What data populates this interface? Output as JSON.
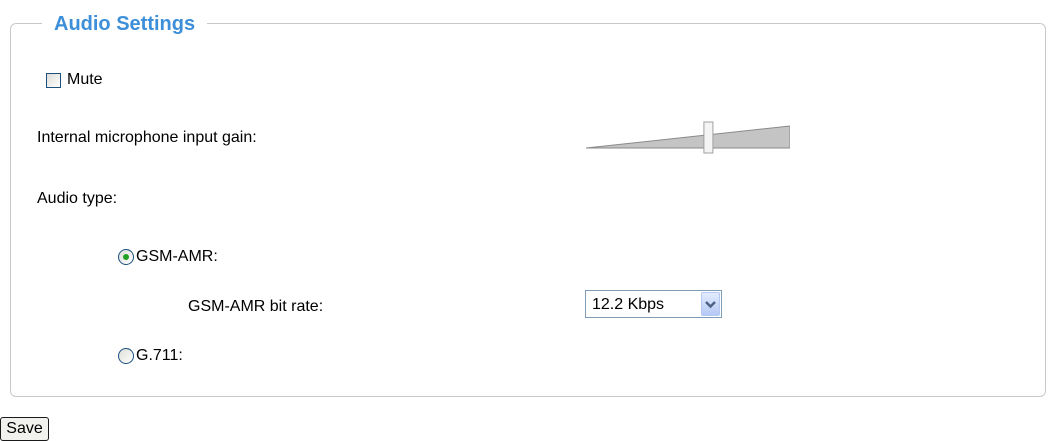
{
  "section": {
    "title": "Audio Settings"
  },
  "mute": {
    "label": "Mute",
    "checked": false
  },
  "gain": {
    "label": "Internal microphone input gain:",
    "level_fraction": 0.6
  },
  "audio_type": {
    "label": "Audio type:",
    "options": [
      {
        "label": "GSM-AMR:",
        "selected": true
      },
      {
        "label": "G.711:",
        "selected": false
      }
    ],
    "gsm_amr_bitrate": {
      "label": "GSM-AMR bit rate:",
      "value": "12.2 Kbps"
    }
  },
  "actions": {
    "save_label": "Save"
  },
  "colors": {
    "title": "#3c8fd8",
    "border": "#c9c9c9",
    "radio_dot": "#21a121"
  },
  "icons": {
    "select_arrow": "chevron-down-icon"
  }
}
